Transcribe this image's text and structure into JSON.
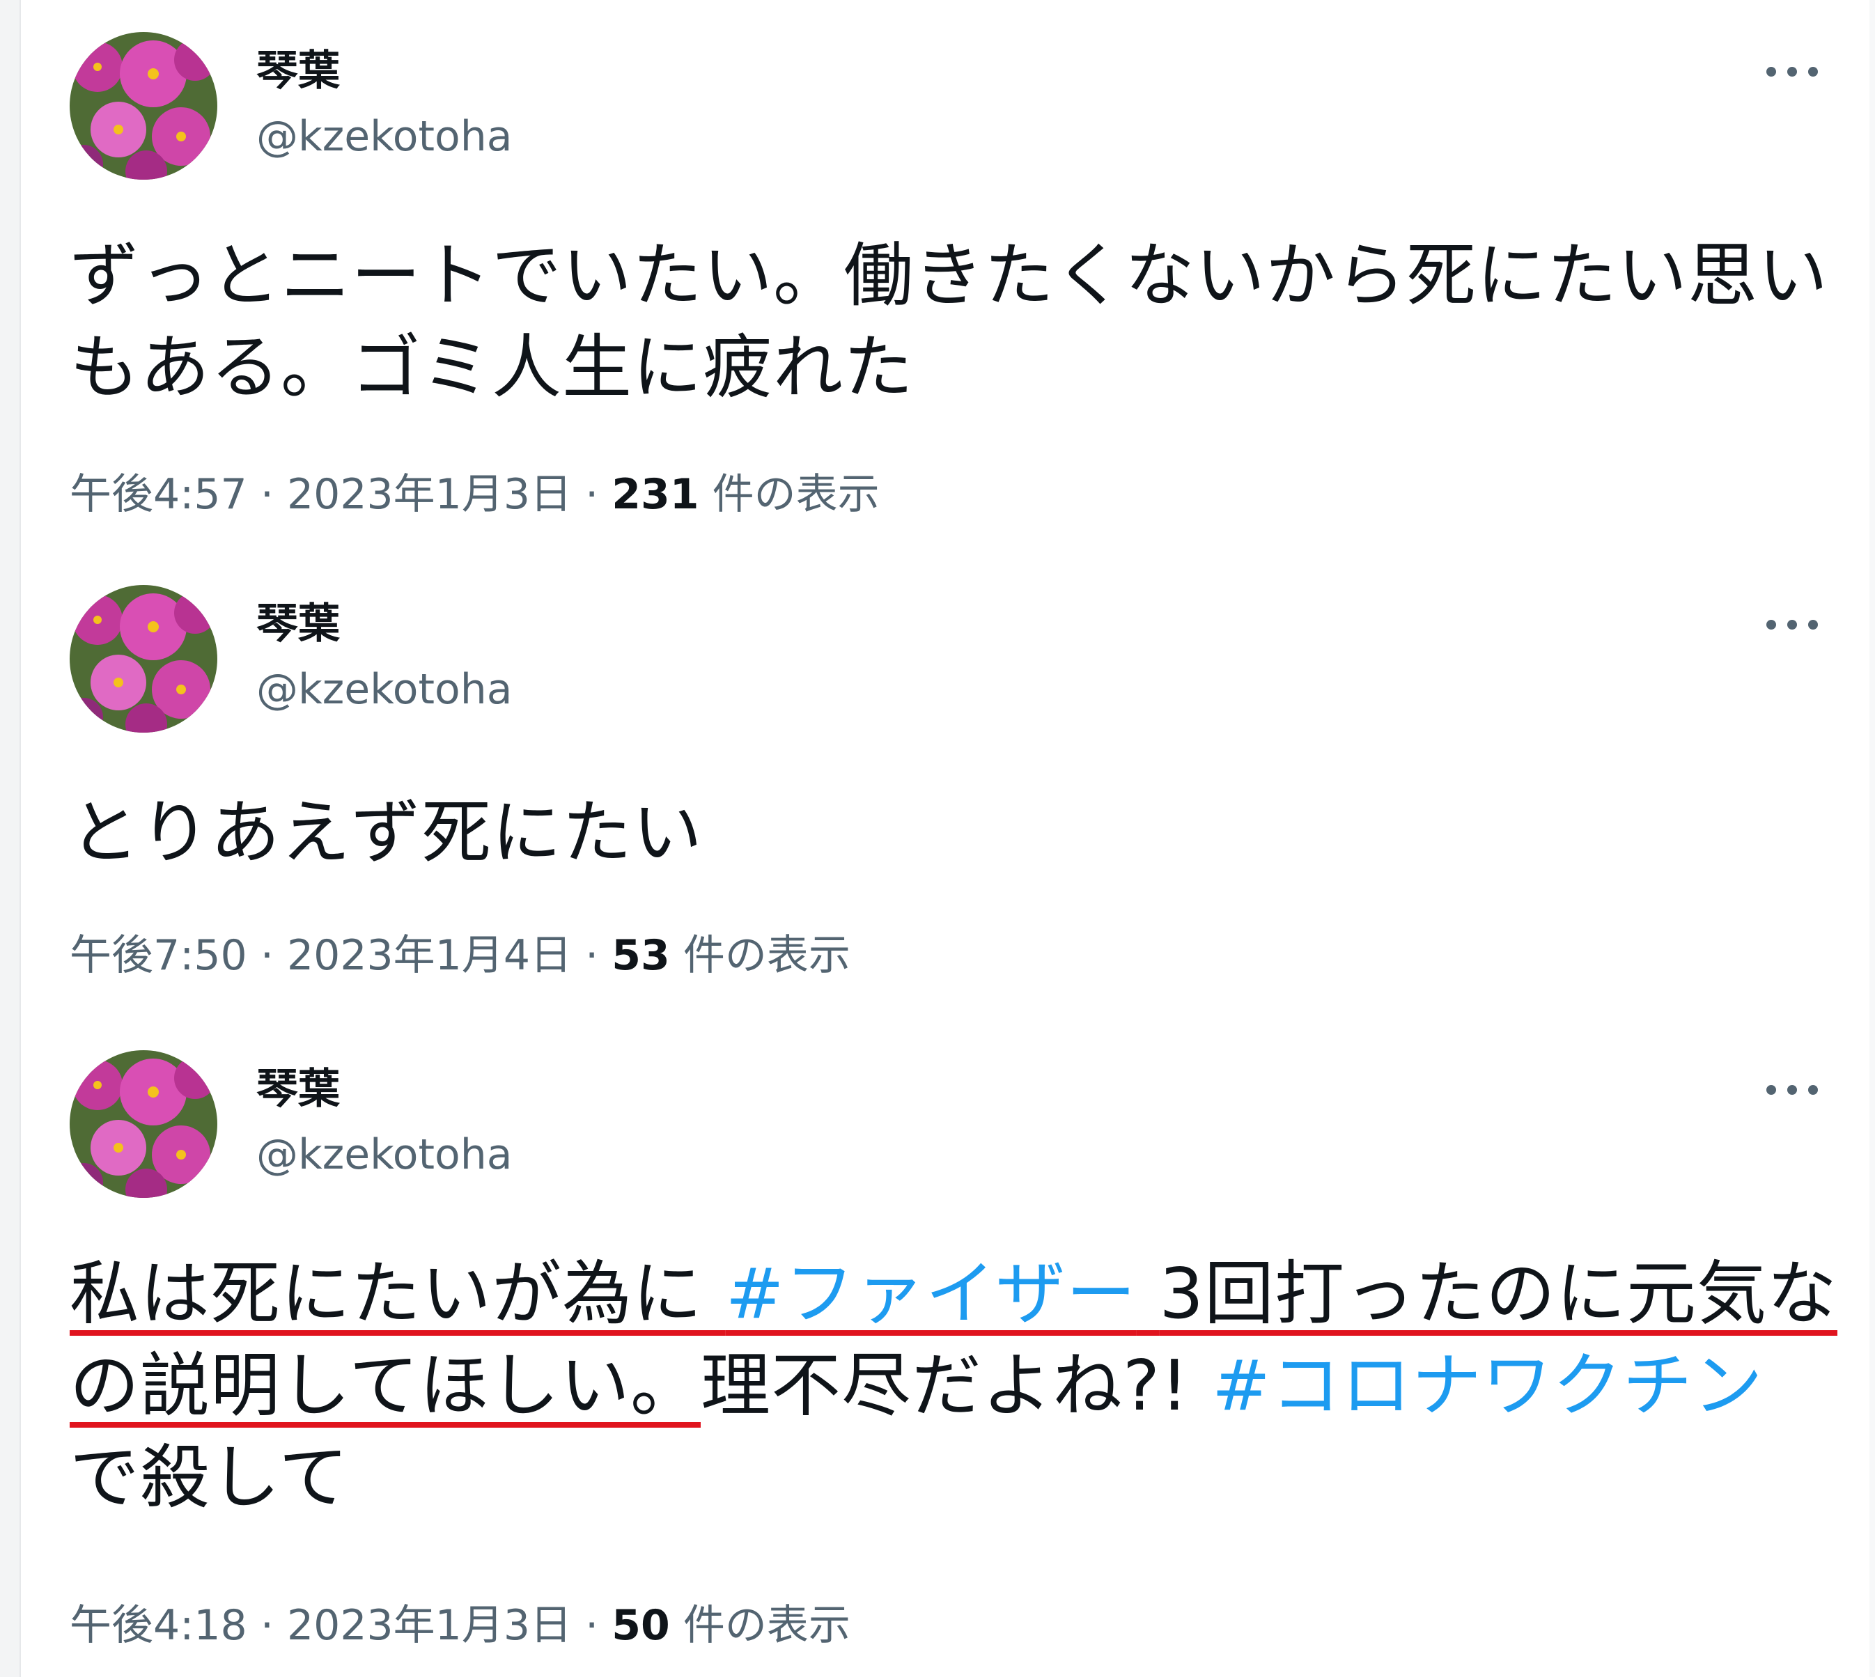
{
  "tweets": [
    {
      "name": "琴葉",
      "handle": "@kzekotoha",
      "text": "ずっとニートでいたい。働きたくないから死にたい思いもある。ゴミ人生に疲れた",
      "time": "午後4:57",
      "sep1": "·",
      "date": "2023年1月3日",
      "sep2": "·",
      "views_count": "231",
      "views_label": "件の表示"
    },
    {
      "name": "琴葉",
      "handle": "@kzekotoha",
      "text": "とりあえず死にたい",
      "time": "午後7:50",
      "sep1": "·",
      "date": "2023年1月4日",
      "sep2": "·",
      "views_count": "53",
      "views_label": "件の表示"
    },
    {
      "name": "琴葉",
      "handle": "@kzekotoha",
      "text_parts": {
        "p1": "私は死にたいが為に",
        "h1": "#ファイザー",
        "p2": "3回打ったのに元気なの説明してほしい。",
        "p3": "理不尽だよね?!",
        "h2": "#コロナワクチン",
        "p4": "で殺して"
      },
      "time": "午後4:18",
      "sep1": "·",
      "date": "2023年1月3日",
      "sep2": "·",
      "views_count": "50",
      "views_label": "件の表示"
    }
  ],
  "icons": {
    "more": "more-horizontal-icon",
    "avatar": "cosmos-flower-avatar"
  },
  "colors": {
    "text": "#0f1419",
    "secondary": "#536471",
    "hashtag": "#1d9bf0",
    "underline": "#e0141e"
  }
}
